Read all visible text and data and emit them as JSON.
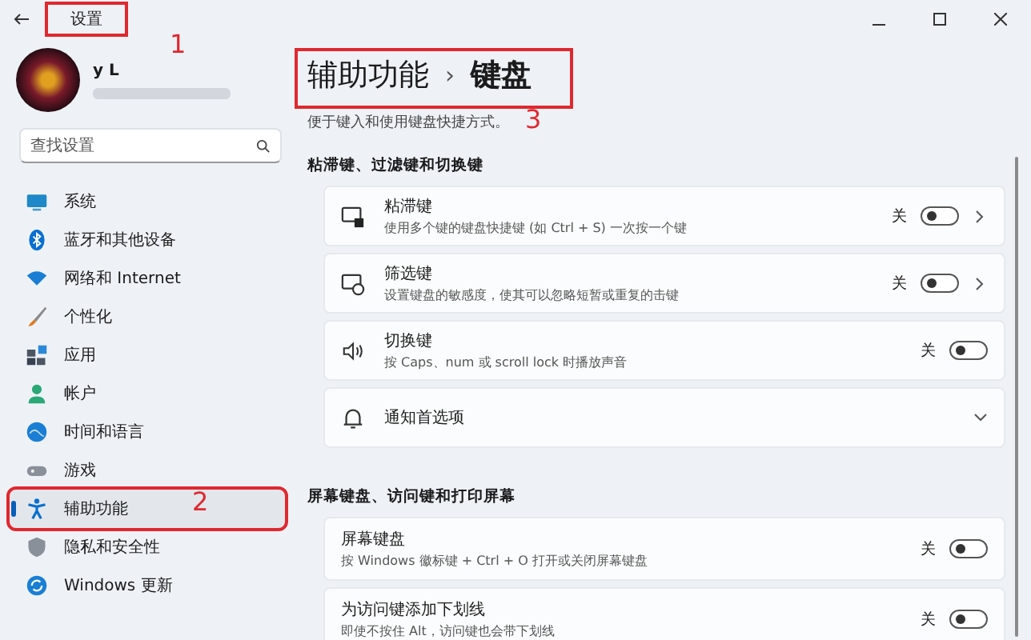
{
  "window": {
    "title": "设置",
    "callout": "1"
  },
  "account": {
    "name": "y L"
  },
  "search": {
    "placeholder": "查找设置"
  },
  "sidebar": {
    "items": [
      {
        "label": "系统",
        "selected": false
      },
      {
        "label": "蓝牙和其他设备",
        "selected": false
      },
      {
        "label": "网络和 Internet",
        "selected": false
      },
      {
        "label": "个性化",
        "selected": false
      },
      {
        "label": "应用",
        "selected": false
      },
      {
        "label": "帐户",
        "selected": false
      },
      {
        "label": "时间和语言",
        "selected": false
      },
      {
        "label": "游戏",
        "selected": false
      },
      {
        "label": "辅助功能",
        "selected": true,
        "callout": "2"
      },
      {
        "label": "隐私和安全性",
        "selected": false
      },
      {
        "label": "Windows 更新",
        "selected": false
      }
    ]
  },
  "breadcrumb": {
    "parent": "辅助功能",
    "separator": "›",
    "current": "键盘",
    "callout": "3"
  },
  "description": "便于键入和使用键盘快捷方式。",
  "sections": [
    {
      "title": "粘滞键、过滤键和切换键",
      "cards": [
        {
          "kind": "link",
          "title": "粘滞键",
          "subtitle": "使用多个键的键盘快捷键 (如 Ctrl + S) 一次按一个键",
          "state_label": "关",
          "on": false
        },
        {
          "kind": "link",
          "title": "筛选键",
          "subtitle": "设置键盘的敏感度，使其可以忽略短暂或重复的击键",
          "state_label": "关",
          "on": false
        },
        {
          "kind": "toggle",
          "title": "切换键",
          "subtitle": "按 Caps、num 或 scroll lock 时播放声音",
          "state_label": "关",
          "on": false
        },
        {
          "kind": "expander",
          "title": "通知首选项"
        }
      ]
    },
    {
      "title": "屏幕键盘、访问键和打印屏幕",
      "cards": [
        {
          "kind": "toggle",
          "title": "屏幕键盘",
          "subtitle": "按 Windows 徽标键 + Ctrl + O 打开或关闭屏幕键盘",
          "state_label": "关",
          "on": false
        },
        {
          "kind": "toggle",
          "title": "为访问键添加下划线",
          "subtitle": "即使不按住 Alt，访问键也会带下划线",
          "state_label": "关",
          "on": false
        }
      ]
    }
  ]
}
